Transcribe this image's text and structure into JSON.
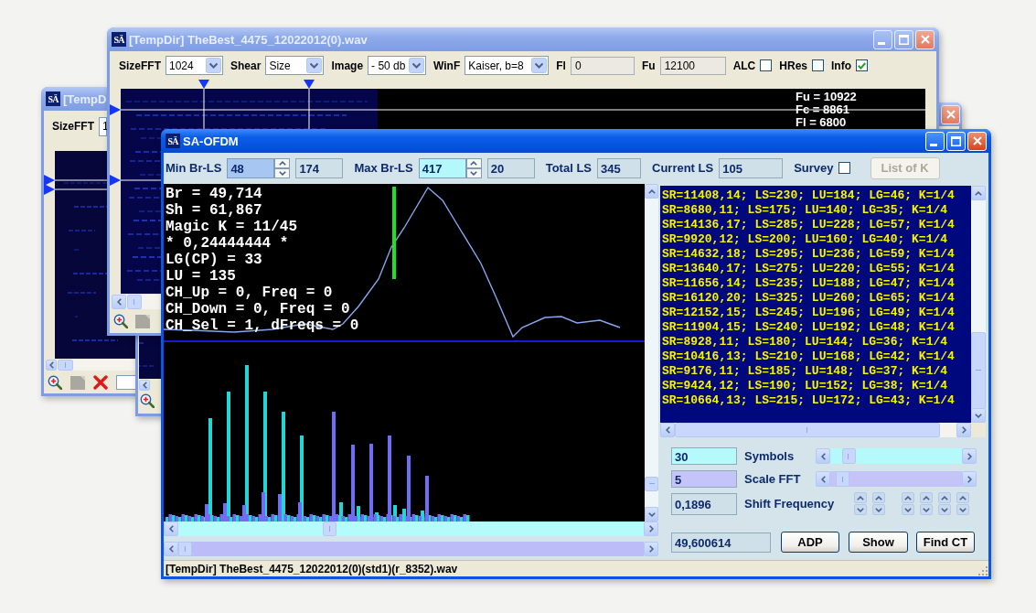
{
  "back_window": {
    "logo": "SÄ",
    "title": "[TempD",
    "toolbar": {
      "label": "SizeFFT",
      "value": "1"
    }
  },
  "spectrum_window": {
    "logo": "SÄ",
    "title": "[TempDir] TheBest_4475_12022012(0).wav",
    "toolbar": [
      {
        "kind": "dropdown",
        "label": "SizeFFT",
        "value": "1024"
      },
      {
        "kind": "dropdown",
        "label": "Shear",
        "value": "Size"
      },
      {
        "kind": "dropdown",
        "label": "Image",
        "value": "- 50 db"
      },
      {
        "kind": "dropdown",
        "label": "WinF",
        "value": "Kaiser, b=8"
      },
      {
        "kind": "field",
        "label": "Fl",
        "value": "0"
      },
      {
        "kind": "field",
        "label": "Fu",
        "value": "12100"
      },
      {
        "kind": "checkbox",
        "label": "ALC",
        "checked": false
      },
      {
        "kind": "checkbox",
        "label": "HRes",
        "checked": false
      },
      {
        "kind": "checkbox",
        "label": "Info",
        "checked": true
      }
    ],
    "readouts": [
      "Fu = 10922",
      "Fc = 8861",
      "Fl = 6800"
    ]
  },
  "ofdm_window": {
    "logo": "SÄ",
    "title": "SA-OFDM",
    "toolbar": [
      {
        "kind": "spin",
        "label": "Min Br-LS",
        "value": "48",
        "color": "#a8c6f2"
      },
      {
        "kind": "output",
        "value": "174"
      },
      {
        "kind": "spin",
        "label": "Max Br-LS",
        "value": "417",
        "color": "#b4f8fc"
      },
      {
        "kind": "output",
        "value": "20"
      },
      {
        "kind": "output",
        "label": "Total LS",
        "value": "345"
      },
      {
        "kind": "output",
        "label": "Current LS",
        "value": "105"
      },
      {
        "kind": "checkbox",
        "label": "Survey",
        "checked": false
      },
      {
        "kind": "button",
        "label": "List of K",
        "disabled": true
      }
    ],
    "readouts": [
      "Br = 49,714",
      "Sh = 61,867",
      "Magic K = 11/45",
      "* 0,24444444 *",
      "LG(CP) = 33",
      "LU = 135",
      "CH_Up = 0, Freq = 0",
      "CH_Down = 0, Freq = 0",
      "CH_Sel = 1, dFreqs = 0"
    ],
    "results": [
      "SR=11408,14; LS=230; LU=184; LG=46; K=1/4",
      "SR=8680,11; LS=175; LU=140; LG=35; K=1/4",
      "SR=14136,17; LS=285; LU=228; LG=57; K=1/4",
      "SR=9920,12; LS=200; LU=160; LG=40; K=1/4",
      "SR=14632,18; LS=295; LU=236; LG=59; K=1/4",
      "SR=13640,17; LS=275; LU=220; LG=55; K=1/4",
      "SR=11656,14; LS=235; LU=188; LG=47; K=1/4",
      "SR=16120,20; LS=325; LU=260; LG=65; K=1/4",
      "SR=12152,15; LS=245; LU=196; LG=49; K=1/4",
      "SR=11904,15; LS=240; LU=192; LG=48; K=1/4",
      "SR=8928,11; LS=180; LU=144; LG=36; K=1/4",
      "SR=10416,13; LS=210; LU=168; LG=42; K=1/4",
      "SR=9176,11; LS=185; LU=148; LG=37; K=1/4",
      "SR=9424,12; LS=190; LU=152; LG=38; K=1/4",
      "SR=10664,13; LS=215; LU=172; LG=43; K=1/4"
    ],
    "controls": [
      {
        "kind": "slider",
        "value": "30",
        "color": "#b4fafa",
        "label": "Symbols",
        "level": 0.1
      },
      {
        "kind": "slider",
        "value": "5",
        "color": "#c4c4f8",
        "label": "Scale FFT",
        "level": 0.05
      },
      {
        "kind": "spinners",
        "value": "0,1896",
        "label": "Shift Frequency"
      }
    ],
    "output": "49,600614",
    "buttons": [
      "ADP",
      "Show",
      "Find CT"
    ],
    "status_bar": "[TempDir] TheBest_4475_12022012(0)(std1)(r_8352).wav"
  }
}
